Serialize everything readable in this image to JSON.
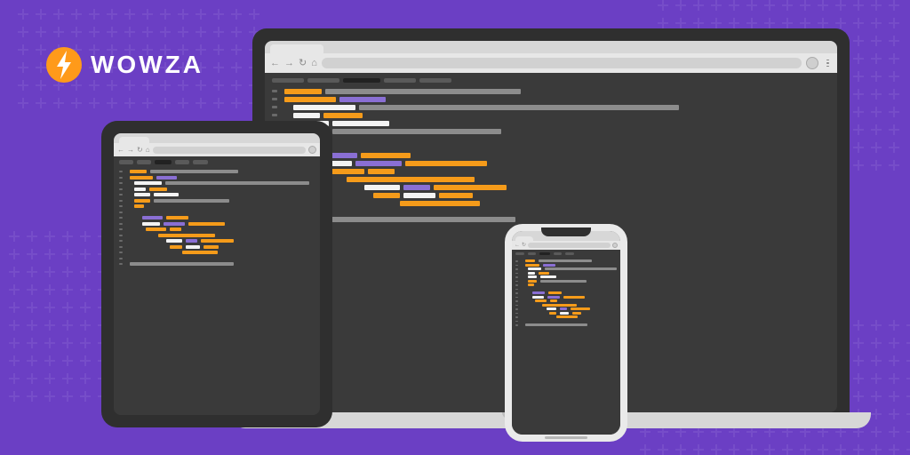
{
  "brand": {
    "name": "WOWZA"
  },
  "colors": {
    "background": "#6b3fc4",
    "accent_orange": "#f59b1a",
    "accent_purple": "#8a6fd4",
    "text_white": "#f3f3f3",
    "comment_grey": "#8c8c8c"
  },
  "devices": [
    "laptop",
    "tablet",
    "phone"
  ],
  "editor": {
    "tabs": [
      {
        "width": 36
      },
      {
        "width": 36
      },
      {
        "width": 42,
        "active": true
      },
      {
        "width": 36
      },
      {
        "width": 36
      }
    ],
    "lines": [
      {
        "indent": 0,
        "segs": [
          [
            "o",
            42
          ],
          [
            "g",
            220
          ]
        ]
      },
      {
        "indent": 0,
        "segs": [
          [
            "o",
            58
          ],
          [
            "p",
            52
          ]
        ]
      },
      {
        "indent": 10,
        "segs": [
          [
            "w",
            70
          ],
          [
            "g",
            360
          ]
        ]
      },
      {
        "indent": 10,
        "segs": [
          [
            "w",
            30
          ],
          [
            "o",
            44
          ]
        ]
      },
      {
        "indent": 10,
        "segs": [
          [
            "w",
            40
          ],
          [
            "w",
            64
          ]
        ]
      },
      {
        "indent": 10,
        "segs": [
          [
            "o",
            40
          ],
          [
            "g",
            190
          ]
        ]
      },
      {
        "indent": 10,
        "segs": [
          [
            "o",
            26
          ]
        ]
      },
      {
        "indent": 0,
        "segs": []
      },
      {
        "indent": 30,
        "segs": [
          [
            "p",
            52
          ],
          [
            "o",
            56
          ]
        ]
      },
      {
        "indent": 30,
        "segs": [
          [
            "w",
            46
          ],
          [
            "p",
            52
          ],
          [
            "o",
            92
          ]
        ]
      },
      {
        "indent": 40,
        "segs": [
          [
            "o",
            50
          ],
          [
            "o",
            30
          ]
        ]
      },
      {
        "indent": 70,
        "segs": [
          [
            "o",
            144
          ]
        ]
      },
      {
        "indent": 90,
        "segs": [
          [
            "w",
            40
          ],
          [
            "p",
            30
          ],
          [
            "o",
            82
          ]
        ]
      },
      {
        "indent": 100,
        "segs": [
          [
            "o",
            30
          ],
          [
            "w",
            36
          ],
          [
            "o",
            38
          ]
        ]
      },
      {
        "indent": 130,
        "segs": [
          [
            "o",
            90
          ]
        ]
      },
      {
        "indent": 0,
        "segs": []
      },
      {
        "indent": 0,
        "segs": [
          [
            "g",
            260
          ]
        ]
      }
    ]
  }
}
